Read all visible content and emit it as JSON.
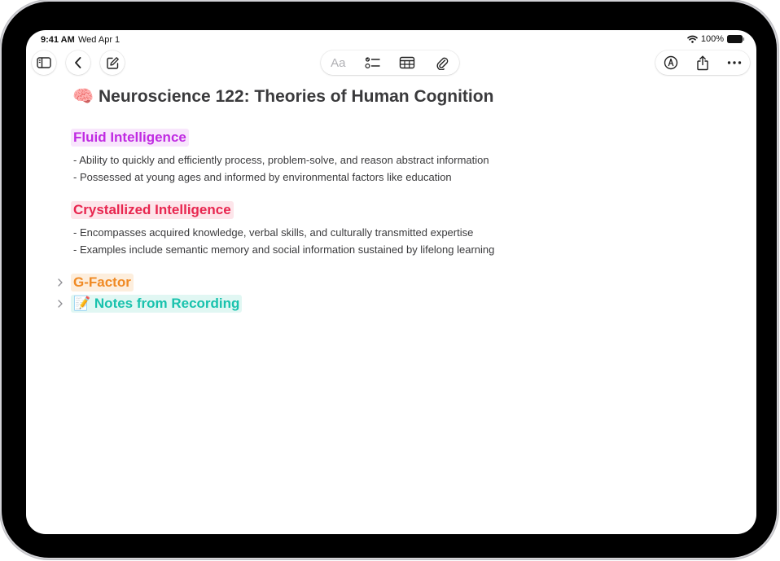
{
  "status_bar": {
    "time": "9:41 AM",
    "date": "Wed Apr 1",
    "battery": "100%"
  },
  "toolbar": {
    "sidebar_icon": "sidebar-icon",
    "back_icon": "chevron-left-icon",
    "compose_icon": "compose-icon",
    "format_label": "Aa",
    "checklist_icon": "checklist-icon",
    "table_icon": "table-icon",
    "attachment_icon": "paperclip-icon",
    "markup_icon": "markup-pen-icon",
    "share_icon": "share-icon",
    "more_icon": "ellipsis-icon"
  },
  "note": {
    "title_emoji": "🧠",
    "title": "Neuroscience 122: Theories of Human Cognition",
    "sections": [
      {
        "heading": "Fluid Intelligence",
        "color": "#c02be2",
        "highlight": "#f8e6fc",
        "bullets": [
          "- Ability to quickly and efficiently process, problem-solve, and reason abstract information",
          "- Possessed at young ages and informed by environmental factors like education"
        ]
      },
      {
        "heading": "Crystallized Intelligence",
        "color": "#e8264f",
        "highlight": "#fde5ea",
        "bullets": [
          "- Encompasses acquired knowledge, verbal skills, and culturally transmitted expertise",
          "- Examples include semantic memory and social information sustained by lifelong learning"
        ]
      }
    ],
    "collapsed_sections": [
      {
        "heading": "G-Factor",
        "color": "#f08a24",
        "highlight": "#fdeedd"
      },
      {
        "emoji": "📝",
        "heading": "Notes from Recording",
        "color": "#19c2ad",
        "highlight": "#e1f7f3"
      }
    ]
  }
}
